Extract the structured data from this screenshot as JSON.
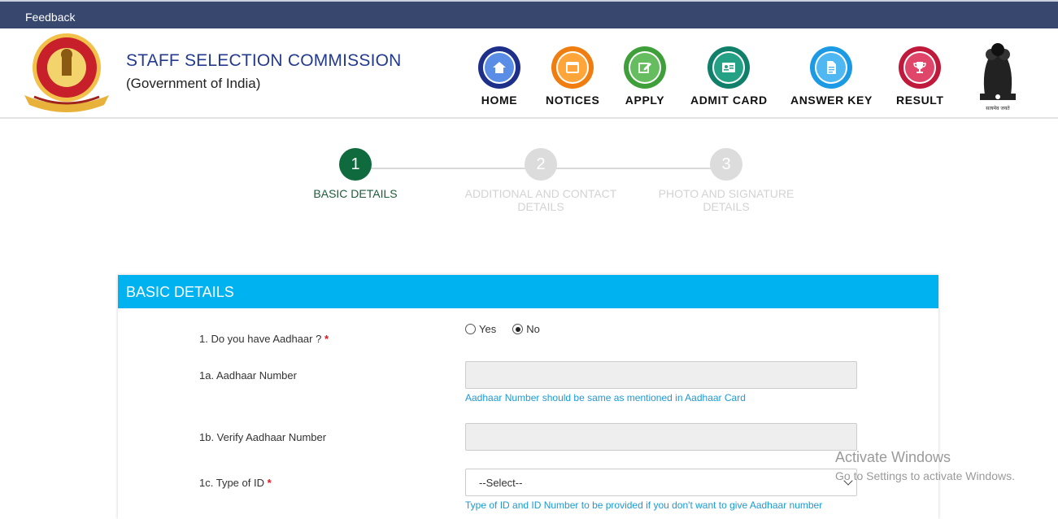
{
  "topbar": {
    "feedback": "Feedback"
  },
  "header": {
    "title": "STAFF SELECTION COMMISSION",
    "subtitle": "(Government of India)",
    "logo_icon": "ssc-seal-icon",
    "emblem_icon": "national-emblem-icon",
    "emblem_motto": "सत्यमेव जयते"
  },
  "nav": [
    {
      "label": "HOME",
      "icon": "home-icon",
      "outer": "#1e2f8a",
      "inner": "#5a8ee6"
    },
    {
      "label": "NOTICES",
      "icon": "notice-icon",
      "outer": "#f07d10",
      "inner": "#ffa53a"
    },
    {
      "label": "APPLY",
      "icon": "edit-icon",
      "outer": "#3f9f3a",
      "inner": "#66bd5f"
    },
    {
      "label": "ADMIT CARD",
      "icon": "id-card-icon",
      "outer": "#11806a",
      "inner": "#25a186"
    },
    {
      "label": "ANSWER KEY",
      "icon": "document-icon",
      "outer": "#1c9ae4",
      "inner": "#4fb7f2"
    },
    {
      "label": "RESULT",
      "icon": "trophy-icon",
      "outer": "#bf1a3b",
      "inner": "#e0466a"
    }
  ],
  "steps": [
    {
      "num": "1",
      "label": "BASIC DETAILS",
      "active": true
    },
    {
      "num": "2",
      "label": "ADDITIONAL AND CONTACT DETAILS",
      "active": false
    },
    {
      "num": "3",
      "label": "PHOTO AND SIGNATURE DETAILS",
      "active": false
    }
  ],
  "colors": {
    "active_step": "#0f6b3d",
    "inactive_step": "#dcdcdc",
    "card_header": "#00b3f0",
    "nav_bar": "#37476e",
    "title": "#233a8f"
  },
  "form": {
    "header": "BASIC DETAILS",
    "q1": {
      "label": "1. Do you have Aadhaar ?",
      "required": "*",
      "options": [
        "Yes",
        "No"
      ],
      "selected": "No"
    },
    "q1a": {
      "label": "1a. Aadhaar Number",
      "value": "",
      "hint": "Aadhaar Number should be same as mentioned in Aadhaar Card"
    },
    "q1b": {
      "label": "1b. Verify Aadhaar Number",
      "value": ""
    },
    "q1c": {
      "label": "1c. Type of ID",
      "required": "*",
      "selected": "--Select--",
      "hint": "Type of ID and ID Number to be provided if you don't want to give Aadhaar number"
    }
  },
  "watermark": {
    "line1": "Activate Windows",
    "line2": "Go to Settings to activate Windows."
  }
}
